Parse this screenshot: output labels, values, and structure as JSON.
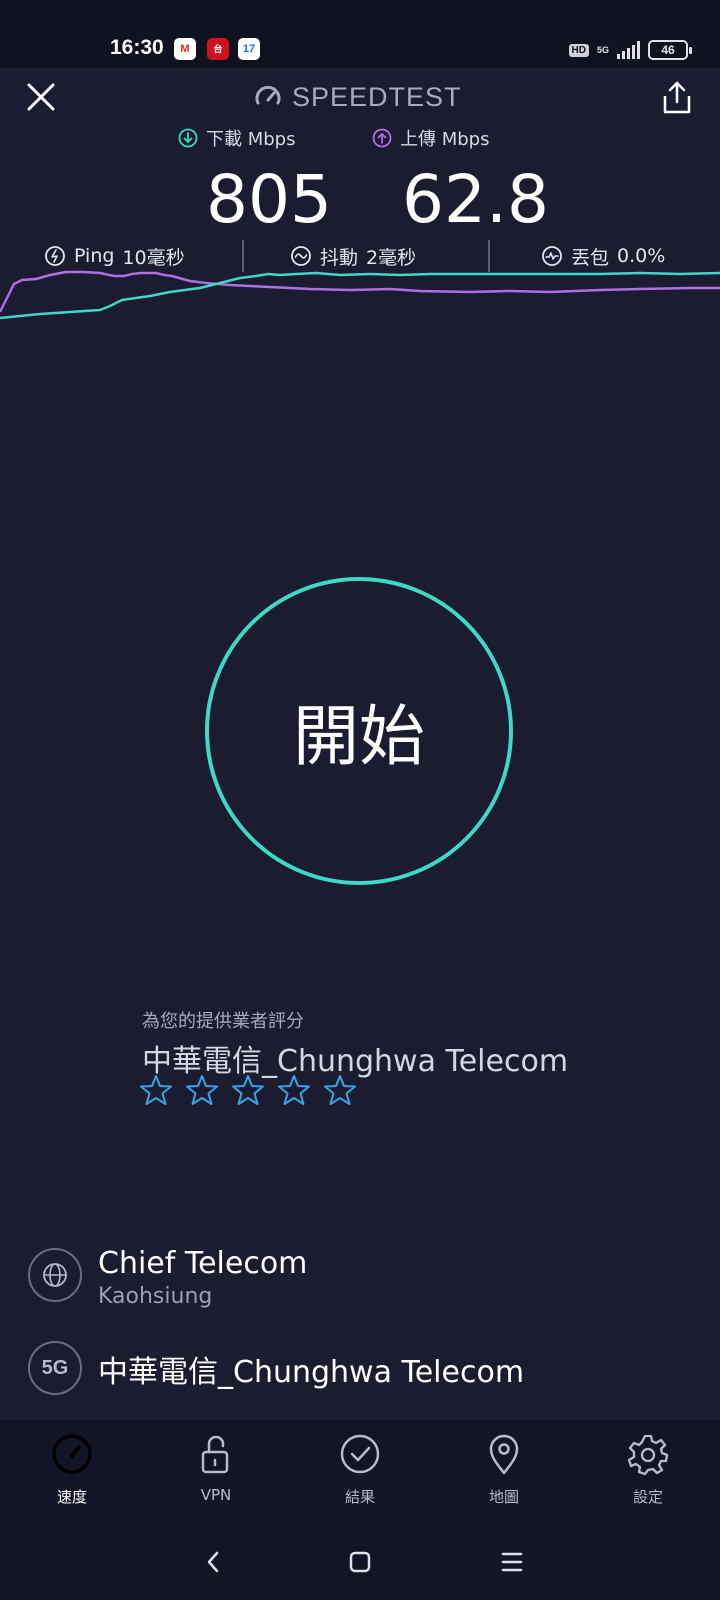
{
  "status_bar": {
    "time": "16:30",
    "app_icons": [
      "M",
      "台",
      "17"
    ],
    "hd_badge": "HD",
    "network_type": "5G",
    "battery_level": "46"
  },
  "header": {
    "brand": "SPEEDTEST",
    "close_icon": "close-icon",
    "share_icon": "share-icon"
  },
  "metrics": {
    "download_label": "下載 Mbps",
    "download_value": "805",
    "upload_label": "上傳 Mbps",
    "upload_value": "62.8"
  },
  "stats": {
    "ping_label": "Ping",
    "ping_value": "10毫秒",
    "jitter_label": "抖動",
    "jitter_value": "2毫秒",
    "loss_label": "丟包",
    "loss_value": "0.0%"
  },
  "colors": {
    "download": "#3fd8c6",
    "upload": "#b06ee8",
    "background": "#1b1c30",
    "star": "#3aa3e8"
  },
  "start_button": {
    "label": "開始"
  },
  "rating": {
    "prompt": "為您的提供業者評分",
    "provider": "中華電信_Chunghwa Telecom",
    "max_stars": 5,
    "filled_stars": 0
  },
  "server": {
    "name": "Chief Telecom",
    "city": "Kaohsiung"
  },
  "carrier": {
    "badge": "5G",
    "name": "中華電信_Chunghwa Telecom"
  },
  "bottom_nav": {
    "items": [
      {
        "label": "速度",
        "icon": "speedometer-icon",
        "active": true
      },
      {
        "label": "VPN",
        "icon": "unlock-icon",
        "active": false
      },
      {
        "label": "結果",
        "icon": "check-circle-icon",
        "active": false
      },
      {
        "label": "地圖",
        "icon": "map-pin-icon",
        "active": false
      },
      {
        "label": "設定",
        "icon": "gear-icon",
        "active": false
      }
    ]
  }
}
